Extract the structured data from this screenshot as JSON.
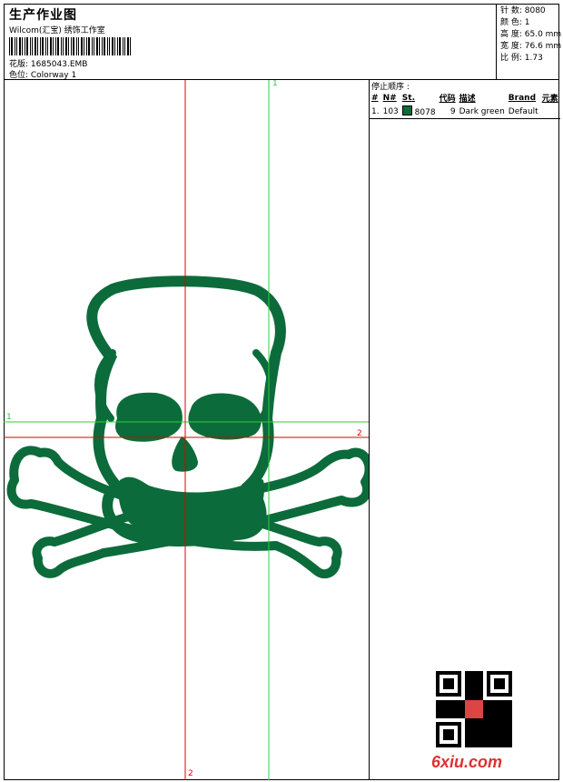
{
  "header": {
    "title": "生产作业图",
    "studio": "Wilcom(汇宝) 绣饰工作室",
    "design_label": "花版: 1685043.EMB",
    "colorway_label": "色位:  Colorway 1"
  },
  "stats": {
    "stitches": "针 数: 8080",
    "colors": "颜 色: 1",
    "height": "高 度: 65.0 mm",
    "width": "宽 度: 76.6 mm",
    "ratio": "比 例: 1.73"
  },
  "stop_sequence": {
    "heading": "停止顺序 :",
    "columns": [
      "#",
      "N#",
      "St.",
      "代码",
      "描述",
      "Brand",
      "元素"
    ],
    "rows": [
      {
        "num": "1.",
        "n": "103",
        "code": "8078",
        "stitches": "9",
        "desc": "Dark green",
        "brand": "Default",
        "color": "#0c6b3a"
      }
    ]
  },
  "guides": {
    "green_v": "1",
    "green_h": "1",
    "red_h": "2",
    "red_v": "2"
  },
  "watermark": "6xiu.com",
  "design_color": "#0c6b3a"
}
